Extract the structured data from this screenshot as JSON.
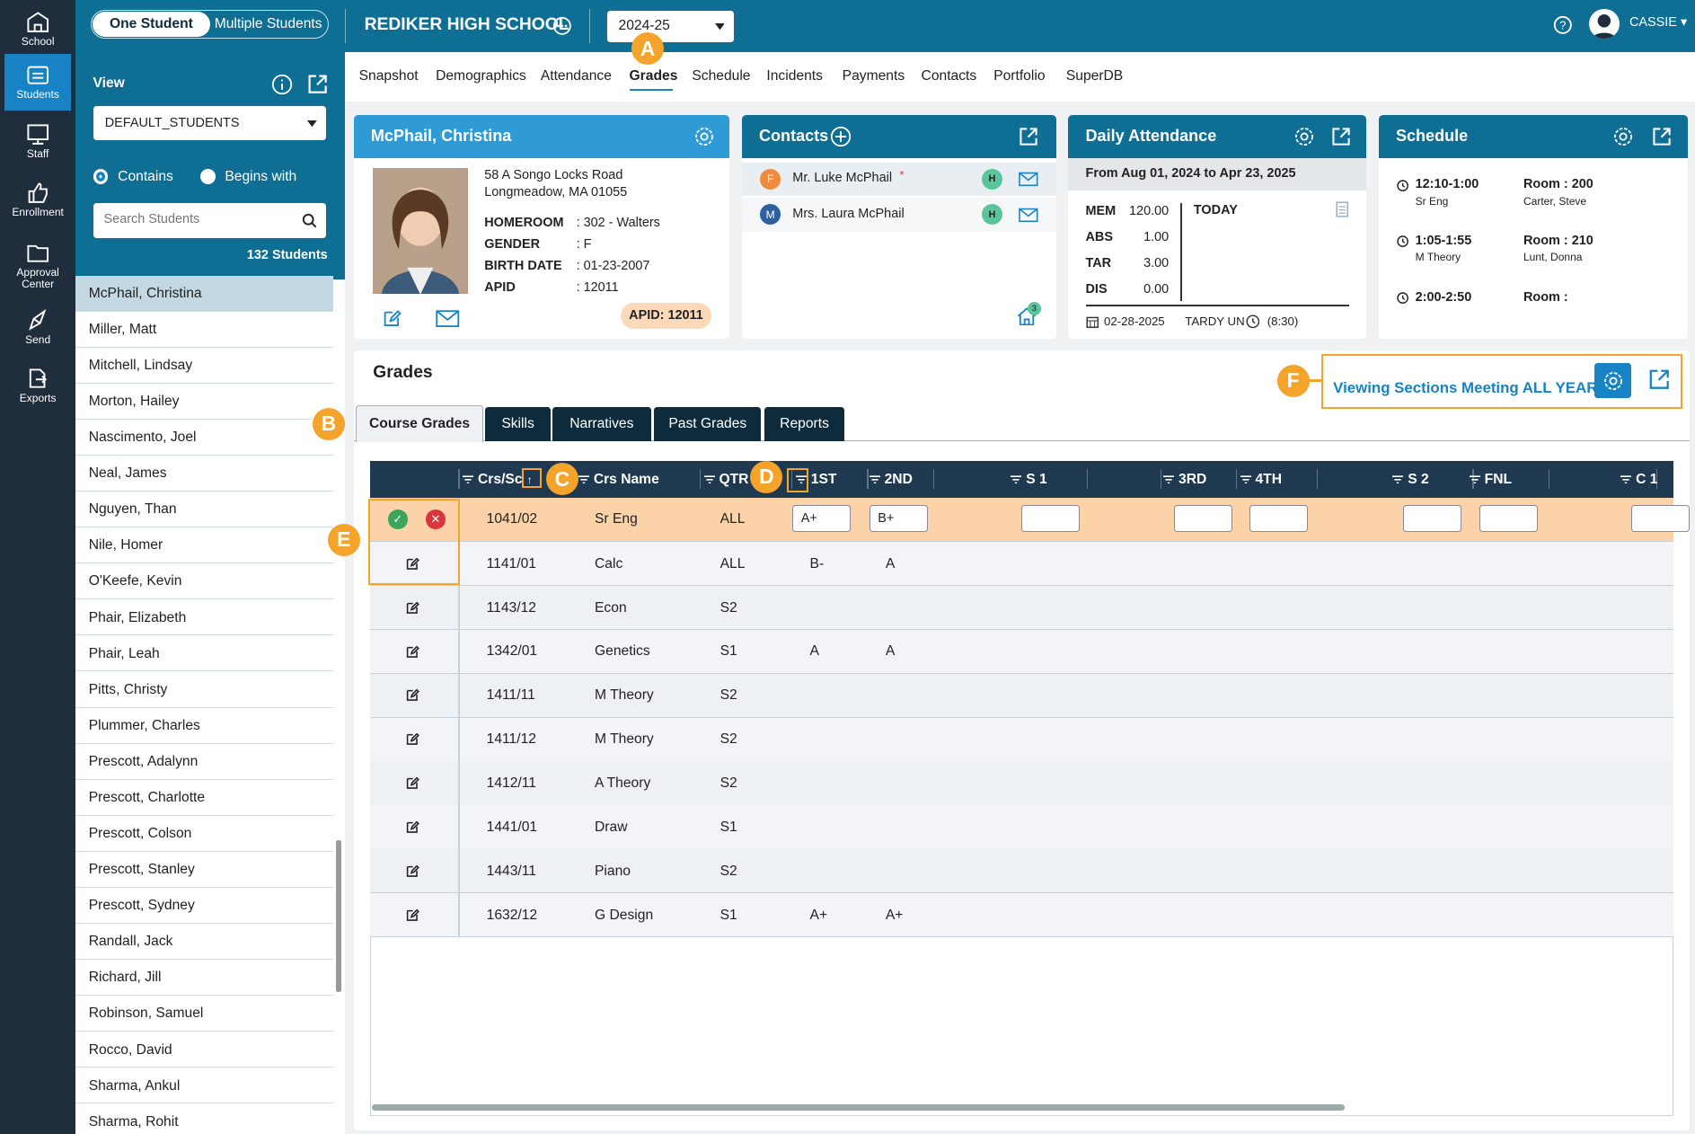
{
  "rail": [
    {
      "label": "School",
      "icon": "school-icon"
    },
    {
      "label": "Students",
      "icon": "students-icon"
    },
    {
      "label": "Staff",
      "icon": "staff-icon"
    },
    {
      "label": "Enrollment",
      "icon": "enrollment-icon"
    },
    {
      "label": "Approval Center",
      "icon": "approval-center-icon"
    },
    {
      "label": "Send",
      "icon": "send-icon"
    },
    {
      "label": "Exports",
      "icon": "exports-icon"
    }
  ],
  "topbar": {
    "seg_one": "One Student",
    "seg_multi": "Multiple Students",
    "school": "REDIKER HIGH SCHOOL",
    "year": "2024-25",
    "user": "CASSIE"
  },
  "left": {
    "view_label": "View",
    "view_select": "DEFAULT_STUDENTS",
    "contains": "Contains",
    "begins": "Begins with",
    "search_placeholder": "Search Students",
    "count": "132 Students",
    "students": [
      "McPhail, Christina",
      "Miller, Matt",
      "Mitchell, Lindsay",
      "Morton, Hailey",
      "Nascimento, Joel",
      "Neal, James",
      "Nguyen, Than",
      "Nile, Homer",
      "O'Keefe, Kevin",
      "Phair, Elizabeth",
      "Phair, Leah",
      "Pitts, Christy",
      "Plummer, Charles",
      "Prescott, Adalynn",
      "Prescott, Charlotte",
      "Prescott, Colson",
      "Prescott, Stanley",
      "Prescott, Sydney",
      "Randall, Jack",
      "Richard, Jill",
      "Robinson, Samuel",
      "Rocco, David",
      "Sharma, Ankul",
      "Sharma, Rohit"
    ]
  },
  "navtabs": [
    "Snapshot",
    "Demographics",
    "Attendance",
    "Grades",
    "Schedule",
    "Incidents",
    "Payments",
    "Contacts",
    "Portfolio",
    "SuperDB"
  ],
  "student": {
    "name": "McPhail, Christina",
    "addr1": "58 A Songo Locks Road",
    "addr2": "Longmeadow, MA 01055",
    "homeroom_l": "HOMEROOM",
    "homeroom_v": ": 302 - Walters",
    "gender_l": "GENDER",
    "gender_v": ": F",
    "birth_l": "BIRTH DATE",
    "birth_v": ": 01-23-2007",
    "apid_l": "APID",
    "apid_v": ": 12011",
    "apid_badge": "APID:  12011"
  },
  "contacts": {
    "title": "Contacts",
    "items": [
      {
        "initial": "F",
        "name": "Mr. Luke McPhail",
        "star": "*",
        "tag": "H"
      },
      {
        "initial": "M",
        "name": "Mrs. Laura McPhail",
        "star": "",
        "tag": "H"
      }
    ],
    "home_badge": "3"
  },
  "attendance": {
    "title": "Daily Attendance",
    "range": "From Aug 01, 2024 to Apr 23, 2025",
    "stats": [
      {
        "k": "MEM",
        "v": "120.00"
      },
      {
        "k": "ABS",
        "v": "1.00"
      },
      {
        "k": "TAR",
        "v": "3.00"
      },
      {
        "k": "DIS",
        "v": "0.00"
      }
    ],
    "today": "TODAY",
    "date": "02-28-2025",
    "tardy": "TARDY UN",
    "time": "(8:30)"
  },
  "schedule": {
    "title": "Schedule",
    "items": [
      {
        "time": "12:10-1:00",
        "course": "Sr Eng",
        "room": "Room : 200",
        "teacher": "Carter, Steve"
      },
      {
        "time": "1:05-1:55",
        "course": "M Theory",
        "room": "Room : 210",
        "teacher": "Lunt, Donna"
      },
      {
        "time": "2:00-2:50",
        "course": "",
        "room": "Room :",
        "teacher": ""
      }
    ]
  },
  "grades": {
    "title": "Grades",
    "viewing": "Viewing Sections Meeting ALL YEAR",
    "tabs": [
      "Course Grades",
      "Skills",
      "Narratives",
      "Past Grades",
      "Reports"
    ],
    "cols": [
      "Crs/Sc",
      "Crs Name",
      "QTR",
      "1ST",
      "2ND",
      "S 1",
      "3RD",
      "4TH",
      "S 2",
      "FNL",
      "C 1"
    ],
    "edit_row": {
      "crs": "1041/02",
      "name": "Sr Eng",
      "qtr": "ALL",
      "g1": "A+",
      "g2": "B+"
    },
    "rows": [
      {
        "crs": "1141/01",
        "name": "Calc",
        "qtr": "ALL",
        "g1": "B-",
        "g2": "A"
      },
      {
        "crs": "1143/12",
        "name": "Econ",
        "qtr": "S2",
        "g1": "",
        "g2": ""
      },
      {
        "crs": "1342/01",
        "name": "Genetics",
        "qtr": "S1",
        "g1": "A",
        "g2": "A"
      },
      {
        "crs": "1411/11",
        "name": "M Theory",
        "qtr": "S2",
        "g1": "",
        "g2": ""
      },
      {
        "crs": "1411/12",
        "name": "M Theory",
        "qtr": "S2",
        "g1": "",
        "g2": ""
      },
      {
        "crs": "1412/11",
        "name": "A Theory",
        "qtr": "S2",
        "g1": "",
        "g2": ""
      },
      {
        "crs": "1441/01",
        "name": "Draw",
        "qtr": "S1",
        "g1": "",
        "g2": ""
      },
      {
        "crs": "1443/11",
        "name": "Piano",
        "qtr": "S2",
        "g1": "",
        "g2": ""
      },
      {
        "crs": "1632/12",
        "name": "G Design",
        "qtr": "S1",
        "g1": "A+",
        "g2": "A+"
      }
    ]
  },
  "callouts": {
    "a": "A",
    "b": "B",
    "c": "C",
    "d": "D",
    "e": "E",
    "f": "F"
  },
  "colors": {
    "topbar": "#0e6e94",
    "rail": "#1f2d3d",
    "accent": "#1782c4",
    "highlight": "#fcd2a8",
    "callout": "#f4a32b"
  }
}
